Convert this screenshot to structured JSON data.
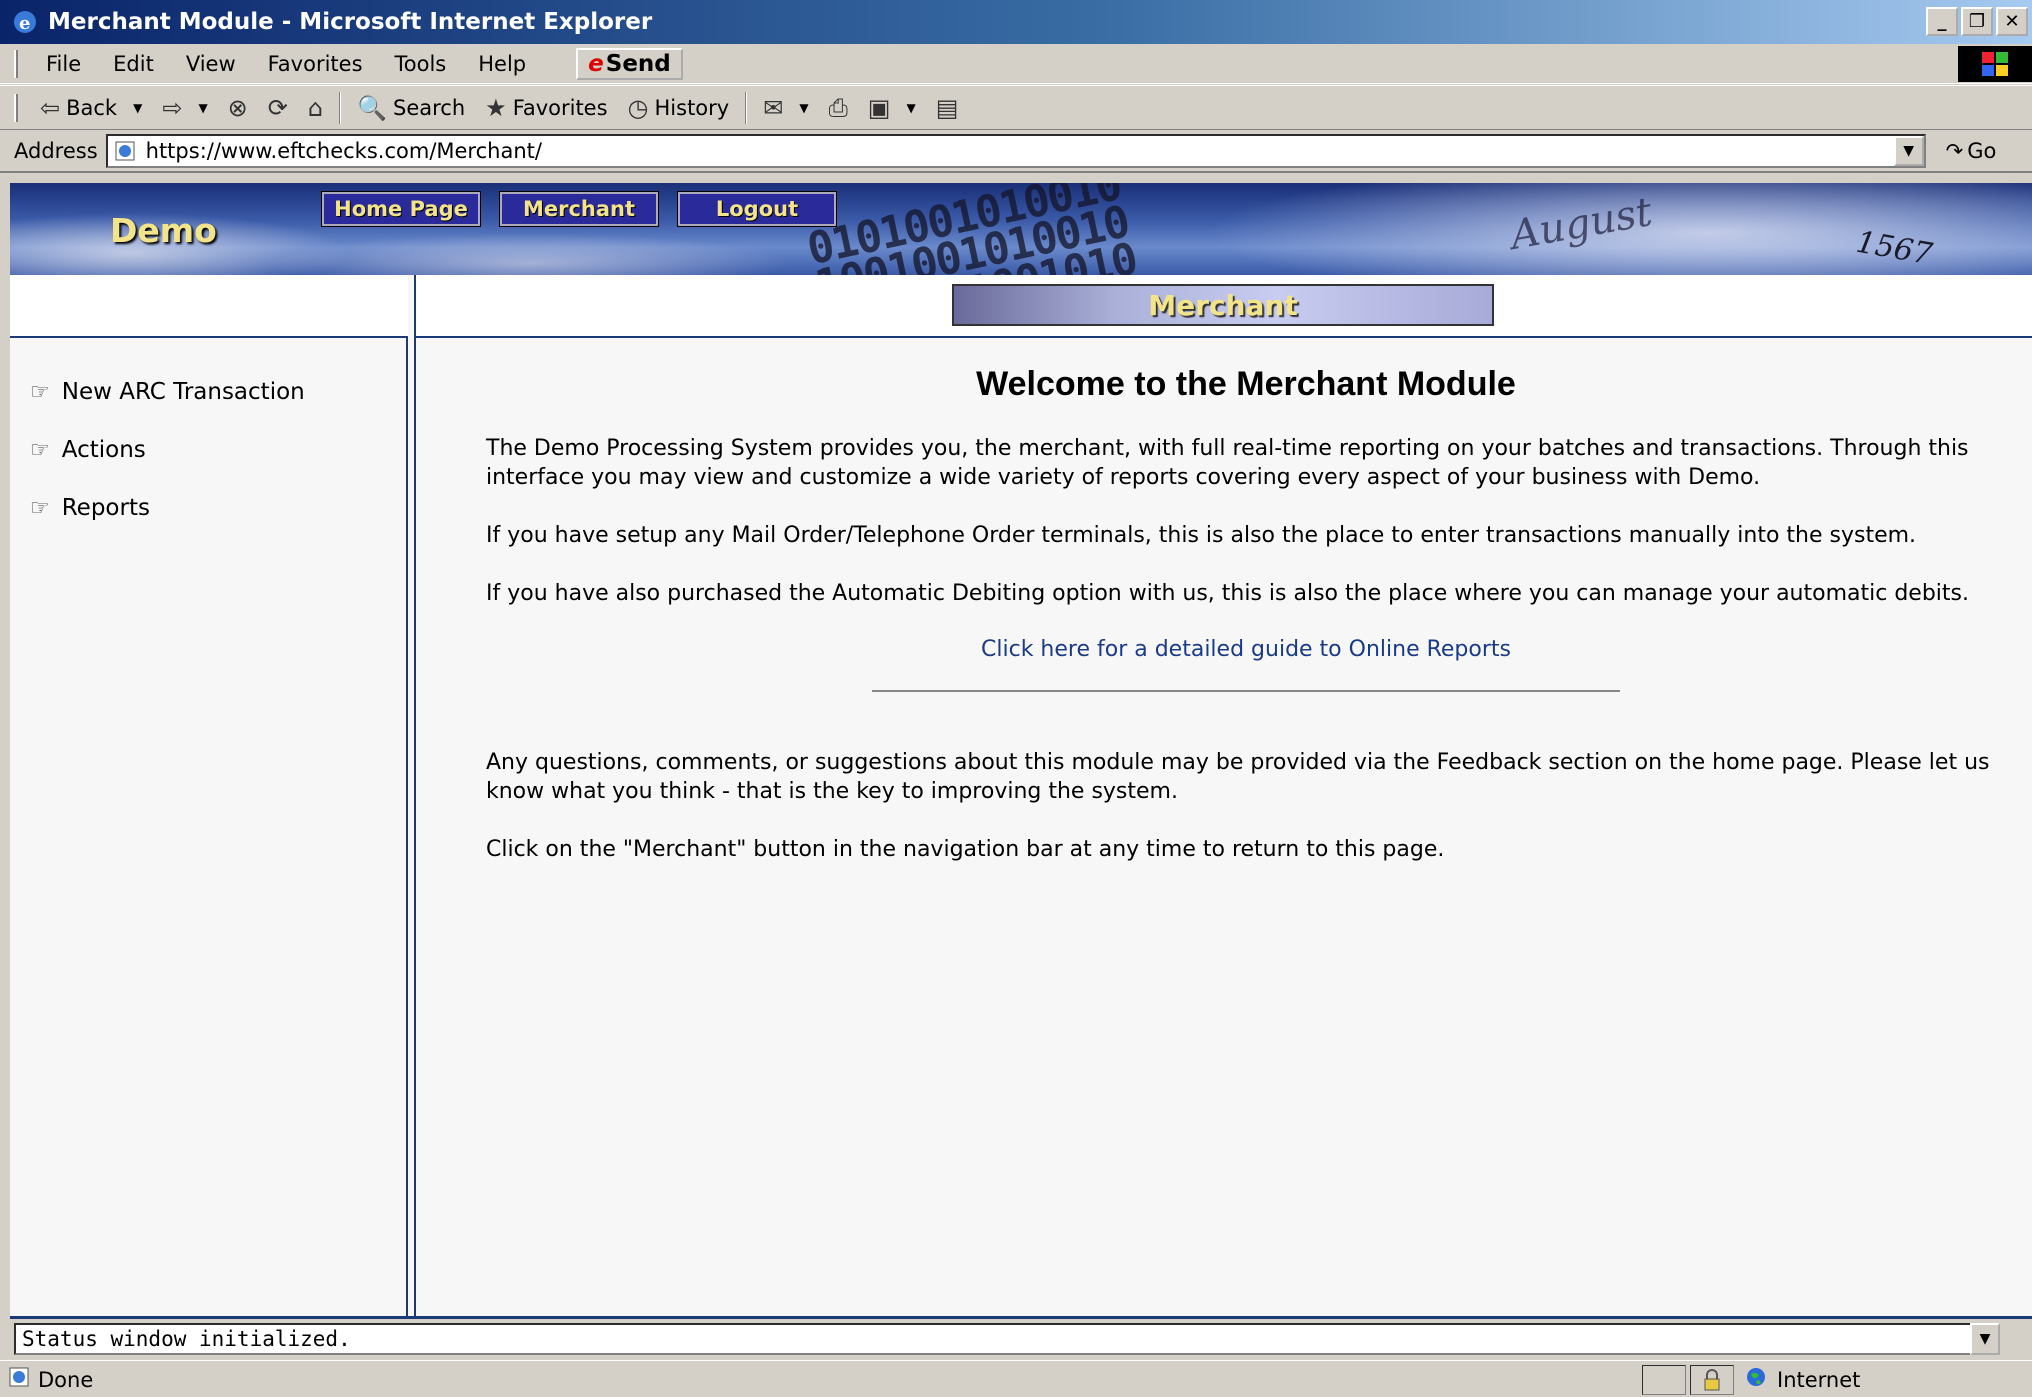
{
  "window": {
    "title": "Merchant Module - Microsoft Internet Explorer",
    "buttons": {
      "minimize": "_",
      "restore": "❐",
      "close": "✕"
    }
  },
  "menu": {
    "items": [
      "File",
      "Edit",
      "View",
      "Favorites",
      "Tools",
      "Help"
    ],
    "send_label": "Send"
  },
  "toolbar": {
    "back_label": "Back",
    "search_label": "Search",
    "favorites_label": "Favorites",
    "history_label": "History"
  },
  "address": {
    "label": "Address",
    "url": "https://www.eftchecks.com/Merchant/",
    "go_label": "Go"
  },
  "banner": {
    "brand": "Demo",
    "nav": [
      "Home Page",
      "Merchant",
      "Logout"
    ],
    "check_number": "1567",
    "signature": "August"
  },
  "sidebar": {
    "items": [
      "New ARC Transaction",
      "Actions",
      "Reports"
    ]
  },
  "main": {
    "section_tab": "Merchant",
    "heading": "Welcome to the Merchant Module",
    "paragraphs": [
      "The Demo Processing System provides you, the merchant, with full real-time reporting on your batches and transactions. Through this interface you may view and customize a wide variety of reports covering every aspect of your business with Demo.",
      "If you have setup any Mail Order/Telephone Order terminals, this is also the place to enter transactions manually into the system.",
      "If you have also purchased the Automatic Debiting option with us, this is also the place where you can manage your automatic debits."
    ],
    "guide_link": "Click here for a detailed guide to Online Reports",
    "paragraphs_after": [
      "Any questions, comments, or suggestions about this module may be provided via the Feedback section on the home page. Please let us know what you think - that is the key to improving the system.",
      "Click on the \"Merchant\" button in the navigation bar at any time to return to this page."
    ]
  },
  "status_window": {
    "text": "Status window initialized."
  },
  "statusbar": {
    "status": "Done",
    "zone": "Internet"
  }
}
